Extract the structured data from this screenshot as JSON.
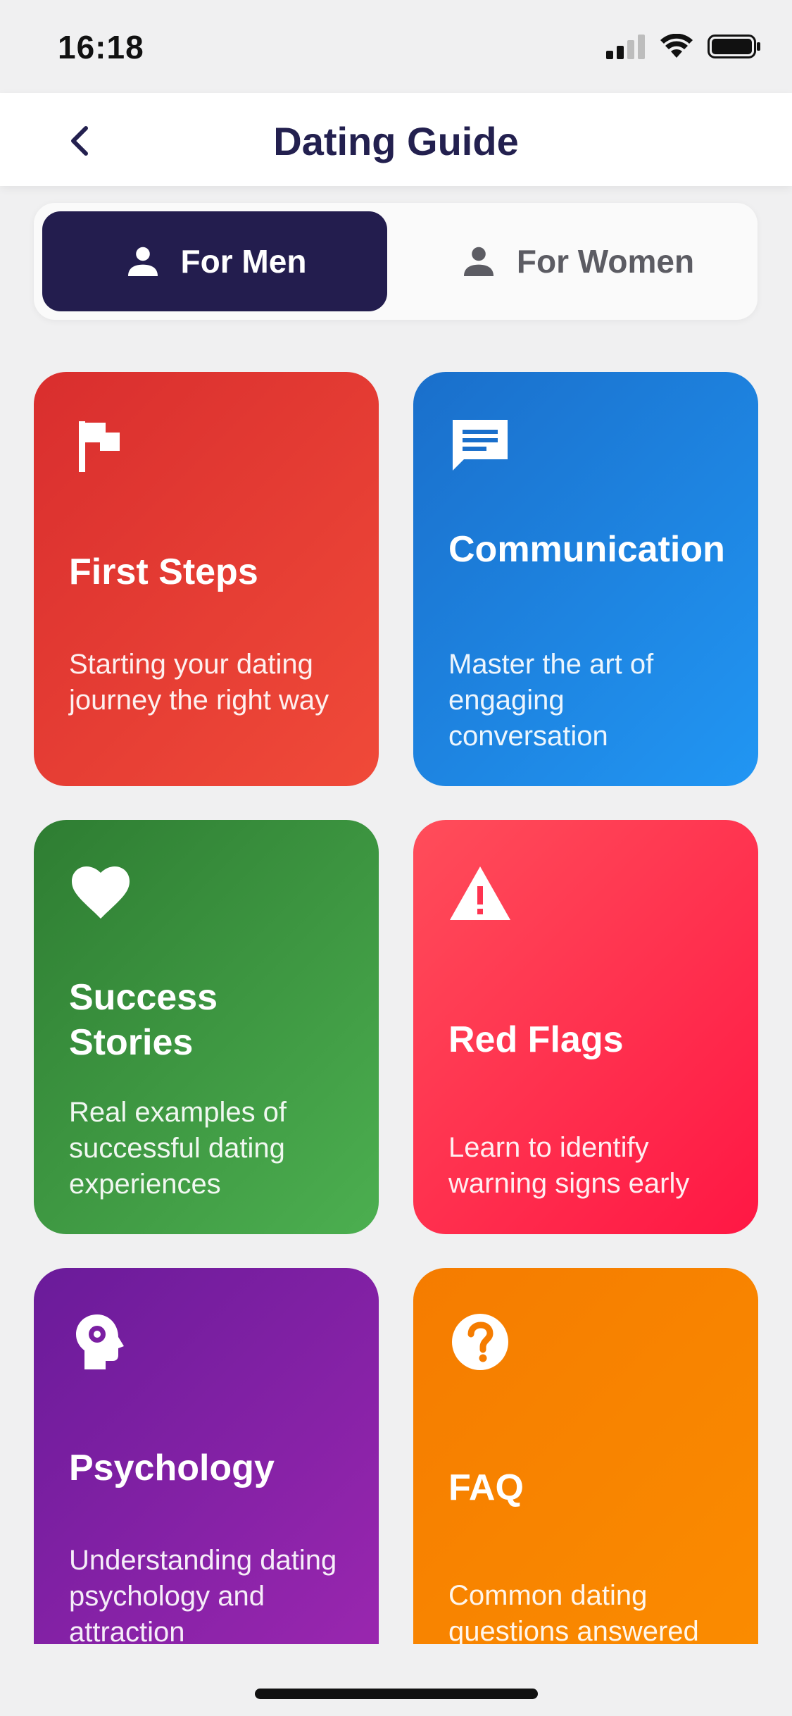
{
  "status_bar": {
    "time": "16:18"
  },
  "header": {
    "title": "Dating Guide"
  },
  "segment": {
    "options": [
      {
        "label": "For Men",
        "selected": true
      },
      {
        "label": "For Women",
        "selected": false
      }
    ]
  },
  "cards": [
    {
      "title": "First Steps",
      "description": "Starting your dating journey the right way",
      "icon": "flag-icon",
      "color": "#E53935"
    },
    {
      "title": "Communication",
      "description": "Master the art of engaging conversation",
      "icon": "chat-icon",
      "color": "#1E88E5"
    },
    {
      "title": "Success Stories",
      "description": "Real examples of successful dating experiences",
      "icon": "heart-icon",
      "color": "#43A047"
    },
    {
      "title": "Red Flags",
      "description": "Learn to identify warning signs early",
      "icon": "warning-icon",
      "color": "#FF1744"
    },
    {
      "title": "Psychology",
      "description": "Understanding dating psychology and attraction",
      "icon": "psychology-icon",
      "color": "#8E24AA"
    },
    {
      "title": "FAQ",
      "description": "Common dating questions answered",
      "icon": "help-icon",
      "color": "#FB8C00"
    }
  ],
  "colors": {
    "accent": "#231D4E",
    "background": "#F0F0F1",
    "title": "#23204F"
  }
}
